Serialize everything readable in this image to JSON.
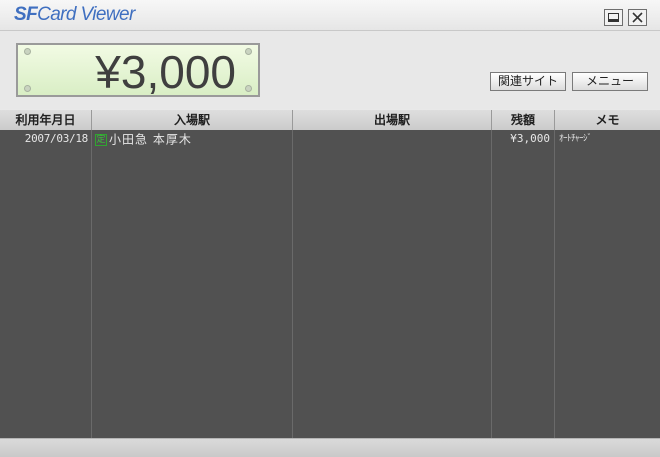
{
  "app": {
    "title_sf": "SF",
    "title_rest": "Card Viewer"
  },
  "header": {
    "balance": "¥3,000",
    "buttons": {
      "related_sites": "関連サイト",
      "menu": "メニュー"
    }
  },
  "table": {
    "columns": [
      "利用年月日",
      "入場駅",
      "出場駅",
      "残額",
      "メモ"
    ],
    "rows": [
      {
        "date": "2007/03/18",
        "type_badge": "定",
        "entry_station": "小田急 本厚木",
        "exit_station": "",
        "balance": "¥3,000",
        "memo": "ｵｰﾄﾁｬｰｼﾞ"
      }
    ]
  },
  "colors": {
    "title_blue": "#3f6fc0",
    "lcd_background": "#e3f3d2",
    "table_background": "#515151",
    "badge_green": "#39c339"
  }
}
